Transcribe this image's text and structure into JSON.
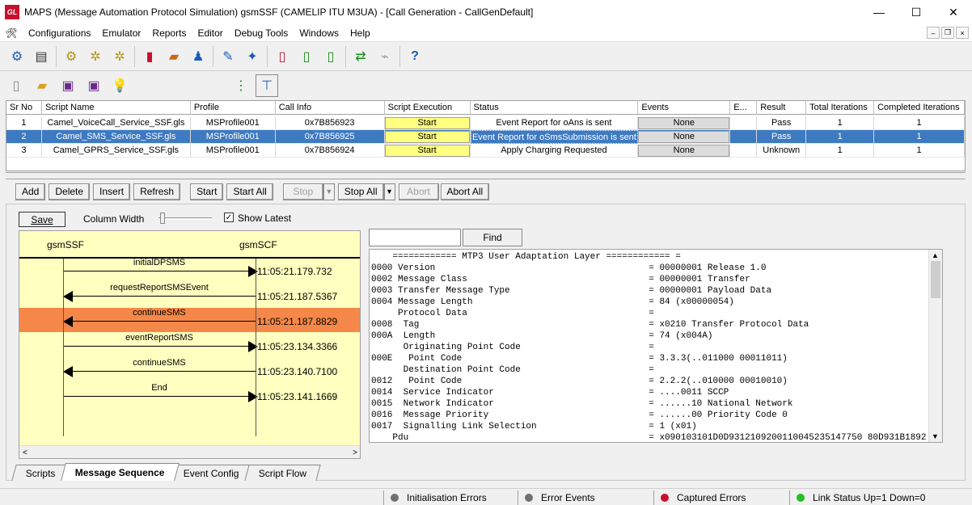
{
  "window": {
    "title": "MAPS (Message Automation Protocol Simulation) gsmSSF (CAMELIP ITU M3UA) - [Call Generation  - CallGenDefault]",
    "logo_text": "GL",
    "minimize": "—",
    "maximize": "☐",
    "close": "✕"
  },
  "menu": {
    "items": [
      "Configurations",
      "Emulator",
      "Reports",
      "Editor",
      "Debug Tools",
      "Windows",
      "Help"
    ],
    "mdi_minimize": "–",
    "mdi_restore": "❐",
    "mdi_close": "×"
  },
  "grid": {
    "headers": [
      "Sr No",
      "Script Name",
      "Profile",
      "Call Info",
      "Script Execution",
      "Status",
      "Events",
      "E...",
      "Result",
      "Total Iterations",
      "Completed Iterations"
    ],
    "rows": [
      {
        "sr": "1",
        "script": "Camel_VoiceCall_Service_SSF.gls",
        "profile": "MSProfile001",
        "call_info": "0x7B856923",
        "execution": "Start",
        "status": "Event Report for oAns is sent",
        "events": "None",
        "e": "",
        "result": "Pass",
        "total": "1",
        "completed": "1"
      },
      {
        "sr": "2",
        "script": "Camel_SMS_Service_SSF.gls",
        "profile": "MSProfile001",
        "call_info": "0x7B856925",
        "execution": "Start",
        "status": "Event Report for oSmsSubmission is sent",
        "events": "None",
        "e": "",
        "result": "Pass",
        "total": "1",
        "completed": "1"
      },
      {
        "sr": "3",
        "script": "Camel_GPRS_Service_SSF.gls",
        "profile": "MSProfile001",
        "call_info": "0x7B856924",
        "execution": "Start",
        "status": "Apply Charging Requested",
        "events": "None",
        "e": "",
        "result": "Unknown",
        "total": "1",
        "completed": "1"
      }
    ]
  },
  "buttons": {
    "add": "Add",
    "delete": "Delete",
    "insert": "Insert",
    "refresh": "Refresh",
    "start": "Start",
    "start_all": "Start All",
    "stop": "Stop",
    "stop_all": "Stop All",
    "abort": "Abort",
    "abort_all": "Abort All"
  },
  "seq_controls": {
    "save": "Save",
    "column_width": "Column Width",
    "show_latest": "Show Latest",
    "show_latest_checked": "✓"
  },
  "sequence": {
    "left_entity": "gsmSSF",
    "right_entity": "gsmSCF",
    "messages": [
      {
        "label": "initialDPSMS",
        "time": "11:05:21.179.732",
        "direction": "right",
        "highlight": false
      },
      {
        "label": "requestReportSMSEvent",
        "time": "11:05:21.187.5367",
        "direction": "left",
        "highlight": false
      },
      {
        "label": "continueSMS",
        "time": "11:05:21.187.8829",
        "direction": "left",
        "highlight": true
      },
      {
        "label": "eventReportSMS",
        "time": "11:05:23.134.3366",
        "direction": "right",
        "highlight": false
      },
      {
        "label": "continueSMS",
        "time": "11:05:23.140.7100",
        "direction": "left",
        "highlight": false
      },
      {
        "label": "End",
        "time": "11:05:23.141.1669",
        "direction": "right",
        "highlight": false
      }
    ],
    "highlight_color": "#f58848"
  },
  "find": {
    "button": "Find",
    "value": ""
  },
  "decode": {
    "lines": [
      "    ============ MTP3 User Adaptation Layer ============ =",
      "0000 Version                                        = 00000001 Release 1.0",
      "0002 Message Class                                  = 00000001 Transfer",
      "0003 Transfer Message Type                          = 00000001 Payload Data",
      "0004 Message Length                                 = 84 (x00000054)",
      "     Protocol Data                                  =",
      "0008  Tag                                           = x0210 Transfer Protocol Data",
      "000A  Length                                        = 74 (x004A)",
      "      Originating Point Code                        =",
      "000E   Point Code                                   = 3.3.3(..011000 00011011)",
      "      Destination Point Code                        =",
      "0012   Point Code                                   = 2.2.2(..010000 00010010)",
      "0014  Service Indicator                             = ....0011 SCCP",
      "0015  Network Indicator                             = ......10 National Network",
      "0016  Message Priority                              = ......00 Priority Code 0",
      "0017  Signalling Link Selection                     = 1 (x01)",
      "    Pdu                                             = x090103101D0D9312109200110045235147750 80D931B1892"
    ]
  },
  "tabs": [
    "Scripts",
    "Message Sequence",
    "Event Config",
    "Script Flow"
  ],
  "status": {
    "init_errors": "Initialisation Errors",
    "error_events": "Error Events",
    "captured_errors": "Captured Errors",
    "link_status": "Link Status Up=1 Down=0"
  }
}
